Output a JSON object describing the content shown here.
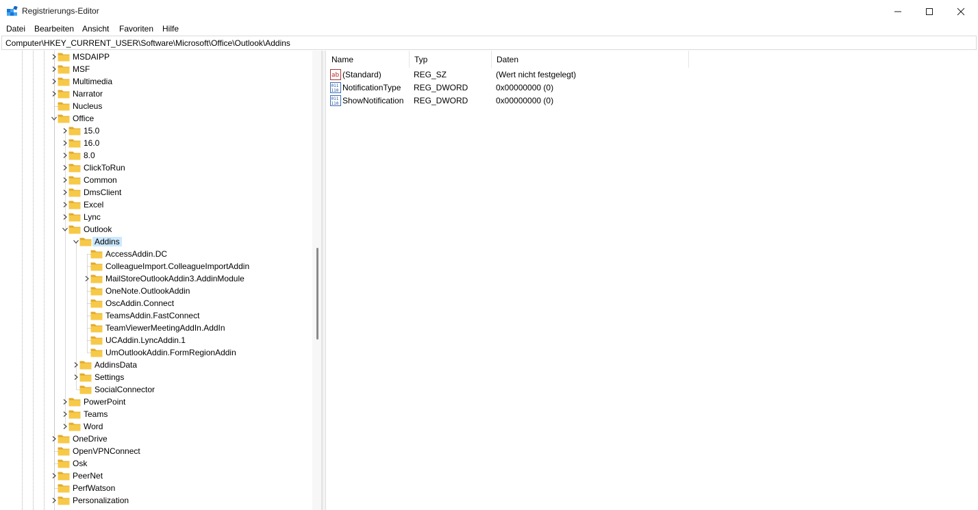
{
  "window": {
    "title": "Registrierungs-Editor",
    "icon": "registry-editor-icon"
  },
  "menu": [
    "Datei",
    "Bearbeiten",
    "Ansicht",
    "Favoriten",
    "Hilfe"
  ],
  "address": "Computer\\HKEY_CURRENT_USER\\Software\\Microsoft\\Office\\Outlook\\Addins",
  "tree": [
    {
      "label": "MSDAIPP",
      "depth": 0,
      "expander": "closed"
    },
    {
      "label": "MSF",
      "depth": 0,
      "expander": "closed"
    },
    {
      "label": "Multimedia",
      "depth": 0,
      "expander": "closed"
    },
    {
      "label": "Narrator",
      "depth": 0,
      "expander": "closed"
    },
    {
      "label": "Nucleus",
      "depth": 0,
      "expander": "none"
    },
    {
      "label": "Office",
      "depth": 0,
      "expander": "open"
    },
    {
      "label": "15.0",
      "depth": 1,
      "expander": "closed"
    },
    {
      "label": "16.0",
      "depth": 1,
      "expander": "closed"
    },
    {
      "label": "8.0",
      "depth": 1,
      "expander": "closed"
    },
    {
      "label": "ClickToRun",
      "depth": 1,
      "expander": "closed"
    },
    {
      "label": "Common",
      "depth": 1,
      "expander": "closed"
    },
    {
      "label": "DmsClient",
      "depth": 1,
      "expander": "closed"
    },
    {
      "label": "Excel",
      "depth": 1,
      "expander": "closed"
    },
    {
      "label": "Lync",
      "depth": 1,
      "expander": "closed"
    },
    {
      "label": "Outlook",
      "depth": 1,
      "expander": "open"
    },
    {
      "label": "Addins",
      "depth": 2,
      "expander": "open",
      "selected": true
    },
    {
      "label": "AccessAddin.DC",
      "depth": 3,
      "expander": "none"
    },
    {
      "label": "ColleagueImport.ColleagueImportAddin",
      "depth": 3,
      "expander": "none"
    },
    {
      "label": "MailStoreOutlookAddin3.AddinModule",
      "depth": 3,
      "expander": "closed"
    },
    {
      "label": "OneNote.OutlookAddin",
      "depth": 3,
      "expander": "none"
    },
    {
      "label": "OscAddin.Connect",
      "depth": 3,
      "expander": "none"
    },
    {
      "label": "TeamsAddin.FastConnect",
      "depth": 3,
      "expander": "none"
    },
    {
      "label": "TeamViewerMeetingAddIn.AddIn",
      "depth": 3,
      "expander": "none"
    },
    {
      "label": "UCAddin.LyncAddin.1",
      "depth": 3,
      "expander": "none"
    },
    {
      "label": "UmOutlookAddin.FormRegionAddin",
      "depth": 3,
      "expander": "none"
    },
    {
      "label": "AddinsData",
      "depth": 2,
      "expander": "closed"
    },
    {
      "label": "Settings",
      "depth": 2,
      "expander": "closed"
    },
    {
      "label": "SocialConnector",
      "depth": 2,
      "expander": "none"
    },
    {
      "label": "PowerPoint",
      "depth": 1,
      "expander": "closed"
    },
    {
      "label": "Teams",
      "depth": 1,
      "expander": "closed"
    },
    {
      "label": "Word",
      "depth": 1,
      "expander": "closed"
    },
    {
      "label": "OneDrive",
      "depth": 0,
      "expander": "closed"
    },
    {
      "label": "OpenVPNConnect",
      "depth": 0,
      "expander": "none"
    },
    {
      "label": "Osk",
      "depth": 0,
      "expander": "none"
    },
    {
      "label": "PeerNet",
      "depth": 0,
      "expander": "closed"
    },
    {
      "label": "PerfWatson",
      "depth": 0,
      "expander": "none"
    },
    {
      "label": "Personalization",
      "depth": 0,
      "expander": "closed"
    }
  ],
  "columns": [
    "Name",
    "Typ",
    "Daten"
  ],
  "values": [
    {
      "name": "(Standard)",
      "type": "REG_SZ",
      "data": "(Wert nicht festgelegt)",
      "icon": "string-value-icon"
    },
    {
      "name": "NotificationType",
      "type": "REG_DWORD",
      "data": "0x00000000 (0)",
      "icon": "binary-value-icon"
    },
    {
      "name": "ShowNotification",
      "type": "REG_DWORD",
      "data": "0x00000000 (0)",
      "icon": "binary-value-icon"
    }
  ],
  "colors": {
    "folder": "#f7c948",
    "folder_dark": "#e2a92a",
    "selection": "#cce8ff",
    "accent": "#0f6cbd"
  }
}
